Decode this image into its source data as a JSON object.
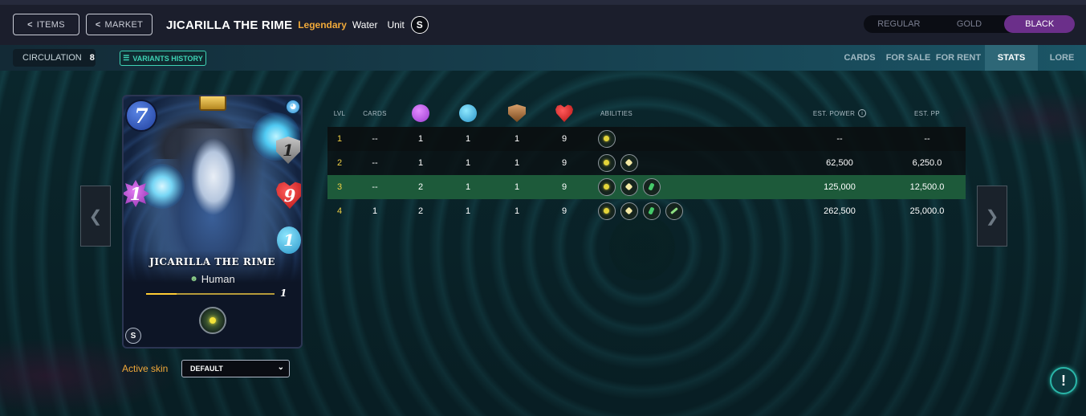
{
  "header": {
    "items_label": "ITEMS",
    "market_label": "MARKET",
    "card_title": "JICARILLA THE RIME",
    "rarity": "Legendary",
    "element": "Water",
    "type": "Unit",
    "variants": [
      "REGULAR",
      "GOLD",
      "BLACK"
    ],
    "active_variant": "BLACK"
  },
  "subbar": {
    "circulation_label": "CIRCULATION",
    "circulation_value": "8",
    "variants_history_label": "VARIANTS HISTORY",
    "tabs": [
      "CARDS",
      "FOR SALE",
      "FOR RENT",
      "STATS",
      "LORE"
    ],
    "active_tab": "STATS"
  },
  "card": {
    "mana": "7",
    "armor": "1",
    "magic": "1",
    "health": "9",
    "speed": "1",
    "name": "JICARILLA THE RIME",
    "race": "Human",
    "level": "1",
    "level_progress": 0.24
  },
  "skin": {
    "label": "Active skin",
    "selected": "DEFAULT"
  },
  "stats_table": {
    "headers": {
      "lvl": "LVL",
      "cards": "CARDS",
      "abilities": "ABILITIES",
      "est_power": "EST. POWER",
      "est_pp": "EST. PP"
    },
    "rows": [
      {
        "lvl": "1",
        "cards": "--",
        "magic": "1",
        "speed": "1",
        "armor": "1",
        "health": "9",
        "abilities": [
          "a1"
        ],
        "power": "--",
        "pp": "--"
      },
      {
        "lvl": "2",
        "cards": "--",
        "magic": "1",
        "speed": "1",
        "armor": "1",
        "health": "9",
        "abilities": [
          "a1",
          "a2"
        ],
        "power": "62,500",
        "pp": "6,250.0"
      },
      {
        "lvl": "3",
        "cards": "--",
        "magic": "2",
        "speed": "1",
        "armor": "1",
        "health": "9",
        "abilities": [
          "a1",
          "a2",
          "a3"
        ],
        "power": "125,000",
        "pp": "12,500.0"
      },
      {
        "lvl": "4",
        "cards": "1",
        "magic": "2",
        "speed": "1",
        "armor": "1",
        "health": "9",
        "abilities": [
          "a1",
          "a2",
          "a3",
          "a4"
        ],
        "power": "262,500",
        "pp": "25,000.0"
      }
    ],
    "highlighted_row": "3"
  },
  "colors": {
    "accent_orange": "#f0a93a",
    "variant_active": "#6b2f8a",
    "teal_accent": "#3ed3b5",
    "row_highlight": "#1d5a3a"
  }
}
